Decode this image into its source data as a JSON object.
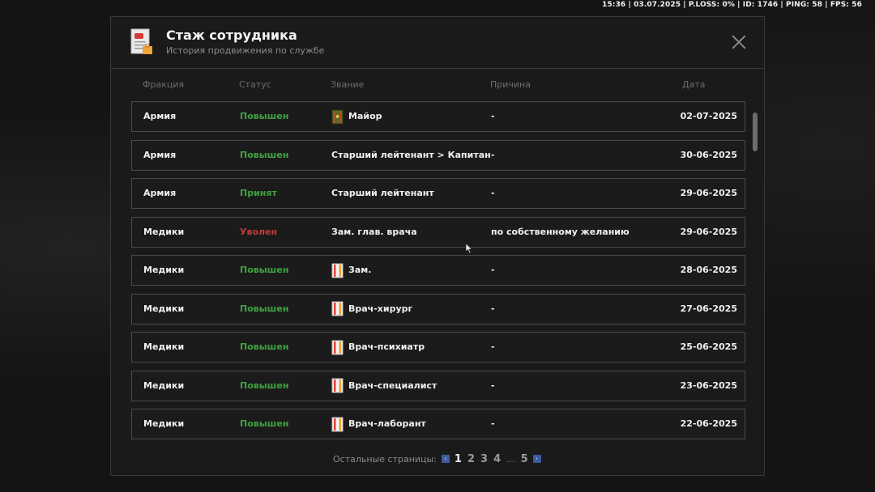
{
  "hud": "15:36 | 03.07.2025 | P.LOSS: 0% | ID: 1746 | PING: 58 | FPS: 56",
  "header": {
    "title": "Стаж сотрудника",
    "subtitle": "История продвижения по службе",
    "icon": "document-icon",
    "close_icon": "close-icon"
  },
  "columns": {
    "faction": "Фракция",
    "status": "Статус",
    "rank": "Звание",
    "reason": "Причина",
    "date": "Дата"
  },
  "colors": {
    "status_up": "#3fa33f",
    "status_fired": "#c23b3b",
    "pager_accent": "#3c5a9e"
  },
  "rows": [
    {
      "faction": "Армия",
      "status": "Повышен",
      "status_type": "up",
      "rank": "Майор",
      "rank_icon": "army-rank-icon",
      "reason": "-",
      "date": "02-07-2025"
    },
    {
      "faction": "Армия",
      "status": "Повышен",
      "status_type": "up",
      "rank": "Старший лейтенант > Капитан",
      "rank_icon": "",
      "reason": "-",
      "date": "30-06-2025"
    },
    {
      "faction": "Армия",
      "status": "Принят",
      "status_type": "up",
      "rank": "Старший лейтенант",
      "rank_icon": "",
      "reason": "-",
      "date": "29-06-2025"
    },
    {
      "faction": "Медики",
      "status": "Уволен",
      "status_type": "fired",
      "rank": "Зам. глав. врача",
      "rank_icon": "",
      "reason": "по собственному желанию",
      "date": "29-06-2025"
    },
    {
      "faction": "Медики",
      "status": "Повышен",
      "status_type": "up",
      "rank": "Зам.",
      "rank_icon": "medic-rank-icon",
      "reason": "-",
      "date": "28-06-2025"
    },
    {
      "faction": "Медики",
      "status": "Повышен",
      "status_type": "up",
      "rank": "Врач-хирург",
      "rank_icon": "medic-rank-icon",
      "reason": "-",
      "date": "27-06-2025"
    },
    {
      "faction": "Медики",
      "status": "Повышен",
      "status_type": "up",
      "rank": "Врач-психиатр",
      "rank_icon": "medic-rank-icon",
      "reason": "-",
      "date": "25-06-2025"
    },
    {
      "faction": "Медики",
      "status": "Повышен",
      "status_type": "up",
      "rank": "Врач-специалист",
      "rank_icon": "medic-rank-icon",
      "reason": "-",
      "date": "23-06-2025"
    },
    {
      "faction": "Медики",
      "status": "Повышен",
      "status_type": "up",
      "rank": "Врач-лаборант",
      "rank_icon": "medic-rank-icon",
      "reason": "-",
      "date": "22-06-2025"
    }
  ],
  "pager": {
    "label": "Остальные страницы:",
    "pages": [
      "1",
      "2",
      "3",
      "4",
      "...",
      "5"
    ],
    "current": "1",
    "prev_icon": "chevron-left-icon",
    "next_icon": "chevron-right-icon",
    "prev_glyph": "‹",
    "next_glyph": "›"
  }
}
